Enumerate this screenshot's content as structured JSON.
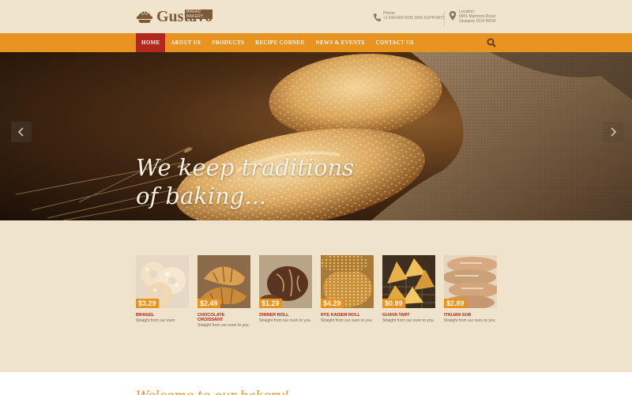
{
  "brand": {
    "name": "Gustavo",
    "tagline": "BREAD BAKERY"
  },
  "contact": {
    "phone_label": "Phone:",
    "phone_value": "+1 919-603-6035 (965-SUPPORT)",
    "location_label": "Location:",
    "location_line1": "8901 Marmora Road",
    "location_line2": "Glasgow, DO4 89GR."
  },
  "nav": {
    "items": [
      {
        "label": "HOME"
      },
      {
        "label": "ABOUT US"
      },
      {
        "label": "PRODUCTS"
      },
      {
        "label": "RECIPE CORNER"
      },
      {
        "label": "NEWS & EVENTS"
      },
      {
        "label": "CONTACT US"
      }
    ],
    "active_index": 0
  },
  "hero": {
    "title_line1": "We keep traditions",
    "title_line2": "of baking..."
  },
  "products": [
    {
      "name": "BRAGEL",
      "price": "$3.29",
      "desc": "Straight from our oven"
    },
    {
      "name": "CHOCOLATE CROISSANT",
      "price": "$2.49",
      "desc": "Straight from our oven to you."
    },
    {
      "name": "DINNER ROLL",
      "price": "$1.29",
      "desc": "Straight from our oven to you."
    },
    {
      "name": "RYE KAISER ROLL",
      "price": "$4.29",
      "desc": "Straight from our oven to you."
    },
    {
      "name": "GUAVA TART",
      "price": "$0.99",
      "desc": "Straight from our oven to you."
    },
    {
      "name": "ITALIAN SUB",
      "price": "$2.89",
      "desc": "Straight from our oven to you."
    }
  ],
  "welcome": {
    "title": "Welcome to our bakery!"
  },
  "colors": {
    "accent": "#e8921f",
    "active": "#b3271d",
    "background": "#efe3cc"
  }
}
